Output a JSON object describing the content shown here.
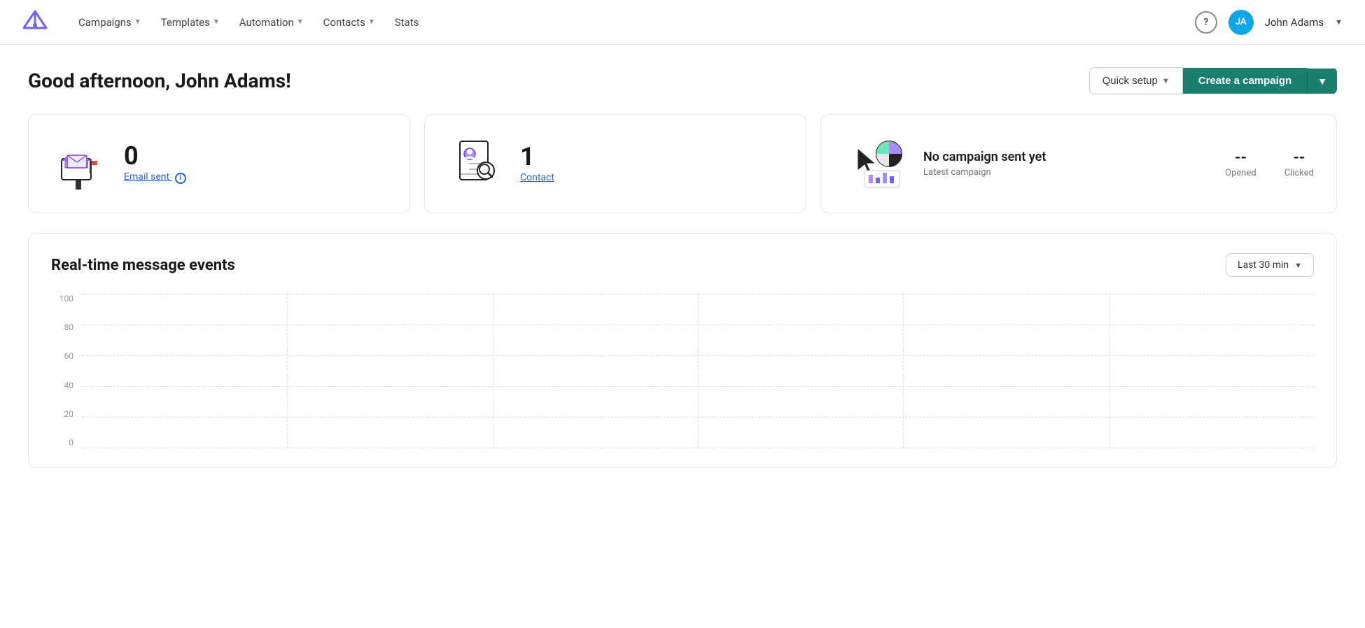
{
  "nav": {
    "logo_alt": "Mailivery logo",
    "items": [
      {
        "label": "Campaigns",
        "has_dropdown": true
      },
      {
        "label": "Templates",
        "has_dropdown": true
      },
      {
        "label": "Automation",
        "has_dropdown": true
      },
      {
        "label": "Contacts",
        "has_dropdown": true
      },
      {
        "label": "Stats",
        "has_dropdown": false
      }
    ],
    "help_label": "?",
    "avatar_initials": "JA",
    "username": "John Adams"
  },
  "header": {
    "greeting": "Good afternoon, John Adams!",
    "quick_setup_label": "Quick setup",
    "create_campaign_label": "Create a campaign"
  },
  "stats": {
    "email_sent_count": "0",
    "email_sent_label": "Email sent",
    "contact_count": "1",
    "contact_label": "Contact",
    "campaign_name": "No campaign sent yet",
    "campaign_sub": "Latest campaign",
    "opened_label": "Opened",
    "opened_value": "--",
    "clicked_label": "Clicked",
    "clicked_value": "--"
  },
  "realtime": {
    "title": "Real-time message events",
    "time_selector_label": "Last 30 min",
    "y_labels": [
      "100",
      "80",
      "60",
      "40",
      "20",
      "0"
    ]
  }
}
